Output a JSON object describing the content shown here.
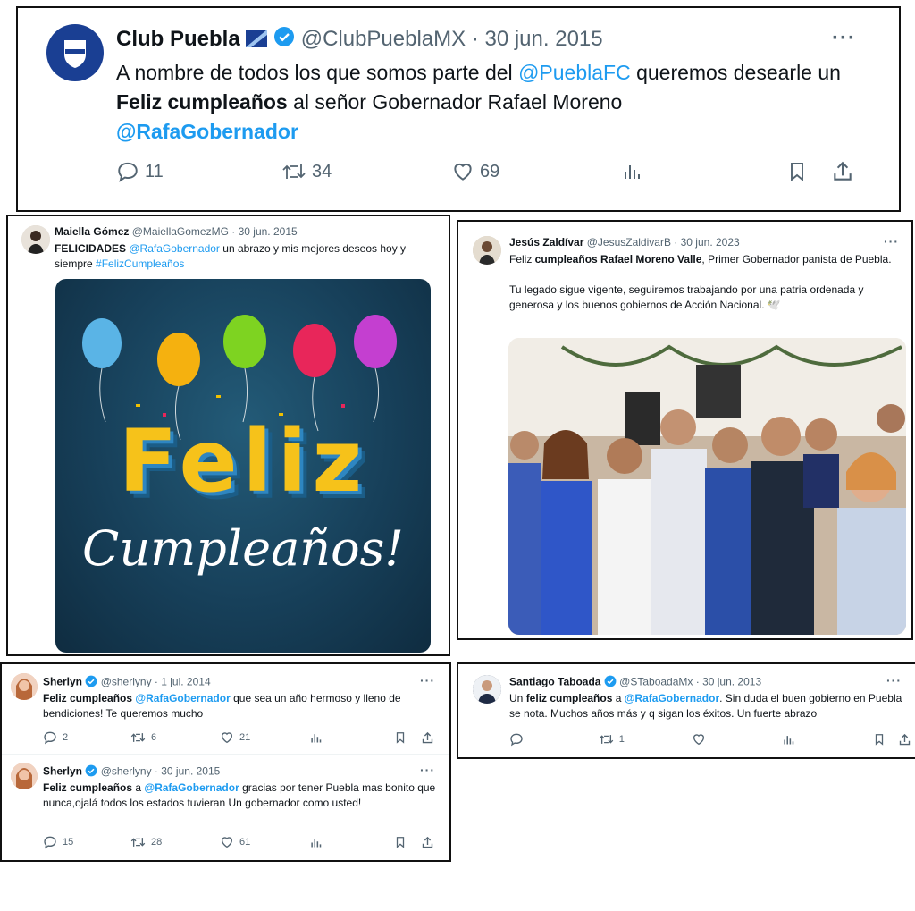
{
  "colors": {
    "link": "#1d9bf0",
    "verified": "#1d9bf0",
    "muted": "#536471"
  },
  "tweets": [
    {
      "name": "Club Puebla",
      "handle": "@ClubPueblaMX",
      "date": "· 30 jun. 2015",
      "text_1": "A nombre de todos los que somos parte del ",
      "mention_1": "@PueblaFC",
      "text_2": " queremos desearle un ",
      "bold_1": "Feliz cumpleaños",
      "text_3": " al señor Gobernador Rafael Moreno ",
      "mention_2": "@RafaGobernador",
      "more": "···",
      "replies": "11",
      "retweets": "34",
      "likes": "69"
    },
    {
      "name": "Maiella Gómez",
      "handle": "@MaiellaGomezMG",
      "date": "· 30 jun. 2015",
      "bold_1": "FELICIDADES",
      "mention_1": "@RafaGobernador",
      "text_1": " un abrazo y mis mejores deseos hoy y siempre ",
      "hashtag": "#FelizCumpleaños",
      "image_line_1": "Feliz",
      "image_line_2": "Cumpleaños!"
    },
    {
      "name": "Jesús Zaldívar",
      "handle": "@JesusZaldivarB",
      "date": "· 30 jun. 2023",
      "text_1": "Feliz ",
      "bold_1": "cumpleaños Rafael Moreno Valle",
      "text_2": ", Primer Gobernador panista de Puebla.",
      "text_3": "Tu legado sigue vigente, seguiremos trabajando por una patria ordenada y generosa y los buenos gobiernos de Acción Nacional. 🕊️",
      "more": "···"
    },
    {
      "name": "Sherlyn",
      "handle": "@sherlyny",
      "date": "· 1 jul. 2014",
      "bold_1": "Feliz cumpleaños",
      "mention_1": "@RafaGobernador",
      "text_1": " que sea un año hermoso y lleno de bendiciones! Te queremos mucho",
      "more": "···",
      "replies": "2",
      "retweets": "6",
      "likes": "21"
    },
    {
      "name": "Sherlyn",
      "handle": "@sherlyny",
      "date": "· 30 jun. 2015",
      "bold_1": "Feliz cumpleaños",
      "text_1": " a ",
      "mention_1": "@RafaGobernador",
      "text_2": " gracias por tener Puebla mas bonito que nunca,ojalá todos los estados tuvieran Un gobernador como usted!",
      "more": "···",
      "replies": "15",
      "retweets": "28",
      "likes": "61"
    },
    {
      "name": "Santiago Taboada",
      "handle": "@STaboadaMx",
      "date": "· 30 jun. 2013",
      "text_1": "Un ",
      "bold_1": "feliz cumpleaños",
      "text_2": " a ",
      "mention_1": "@RafaGobernador",
      "text_3": ". Sin duda el buen gobierno en Puebla se nota. Muchos años más y q sigan los éxitos. Un fuerte abrazo",
      "more": "···",
      "retweets": "1"
    }
  ]
}
